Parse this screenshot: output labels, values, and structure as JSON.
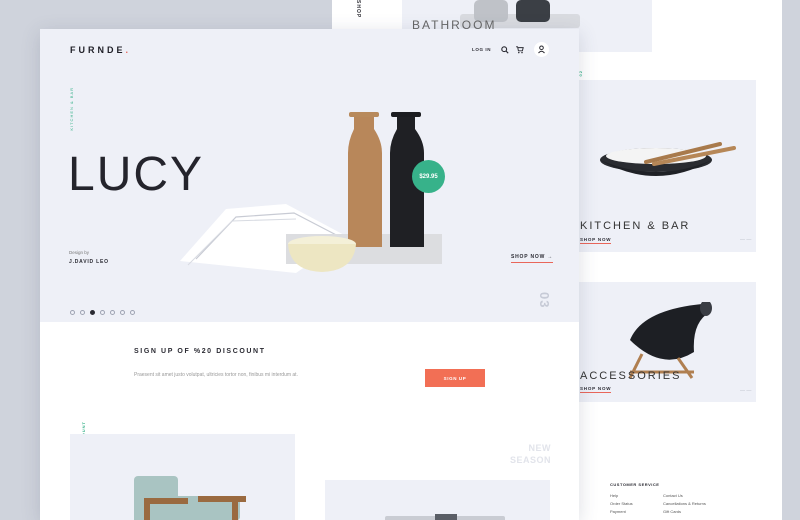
{
  "background": {
    "top_card": {
      "side_label": "SHOP",
      "title": "BATHROOM"
    },
    "kitchen_card": {
      "title": "KITCHEN & BAR",
      "link": "SHOP NOW",
      "side_label": "02"
    },
    "accessories_card": {
      "title": "ACCESSORIES",
      "link": "SHOP NOW"
    },
    "footer": {
      "heading": "CUSTOMER SERVICE",
      "col1": [
        "Help",
        "Order Status",
        "Payment"
      ],
      "col2": [
        "Contact Us",
        "Cancellations & Returns",
        "Gift Cards"
      ]
    }
  },
  "header": {
    "logo": "FURNDE",
    "logo_dot": ".",
    "login": "LOG IN",
    "icons": [
      "search-icon",
      "cart-icon",
      "user-icon"
    ]
  },
  "hero": {
    "side_label": "KITCHEN & BAR",
    "title": "LUCY",
    "design_by": "Design by",
    "designer": "J.DAVID LEO",
    "price": "$29.95",
    "shop_now": "SHOP NOW",
    "slide_number": "03",
    "dots": {
      "count": 7,
      "active_index": 2
    }
  },
  "discount": {
    "title": "SIGN UP OF %20 DISCOUNT",
    "text": "Praesent sit amet justo volutpat, ultricies tortor non, finibus mi interdum at.",
    "button": "SIGN UP"
  },
  "promo": {
    "side_label": "%50 DISCOUNT",
    "season_line1": "NEW",
    "season_line2": "SEASON"
  },
  "colors": {
    "accent": "#e9665a",
    "button": "#f26f55",
    "price_badge": "#37b28a",
    "hero_bg": "#eef0f7",
    "page_bg": "#cfd3dc"
  }
}
